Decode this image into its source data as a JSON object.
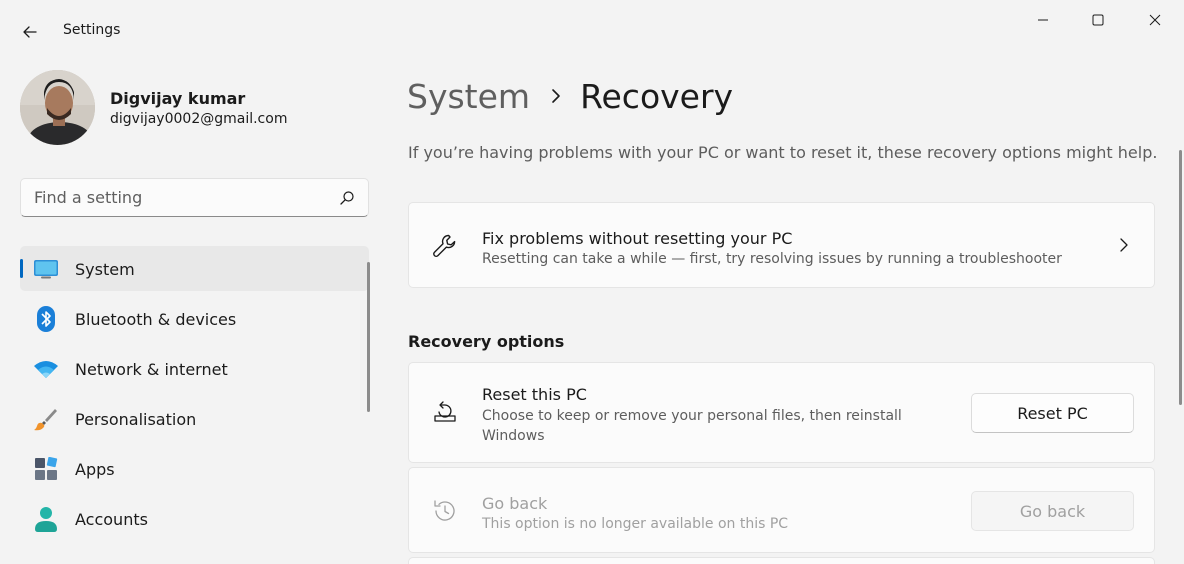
{
  "window": {
    "title": "Settings",
    "controls": {
      "minimize": "minimize-icon",
      "maximize": "maximize-icon",
      "close": "close-icon"
    }
  },
  "profile": {
    "name": "Digvijay kumar",
    "email": "digvijay0002@gmail.com"
  },
  "search": {
    "placeholder": "Find a setting",
    "value": ""
  },
  "sidebar": {
    "accent": "#0067c0",
    "items": [
      {
        "label": "System",
        "icon": "monitor-icon",
        "active": true
      },
      {
        "label": "Bluetooth & devices",
        "icon": "bluetooth-icon"
      },
      {
        "label": "Network & internet",
        "icon": "wifi-icon"
      },
      {
        "label": "Personalisation",
        "icon": "paintbrush-icon"
      },
      {
        "label": "Apps",
        "icon": "apps-icon"
      },
      {
        "label": "Accounts",
        "icon": "account-icon"
      }
    ]
  },
  "main": {
    "breadcrumb": {
      "parent": "System",
      "current": "Recovery"
    },
    "intro": "If you’re having problems with your PC or want to reset it, these recovery options might help.",
    "fix_card": {
      "title": "Fix problems without resetting your PC",
      "description": "Resetting can take a while — first, try resolving issues by running a troubleshooter",
      "icon": "wrench-icon"
    },
    "section_heading": "Recovery options",
    "reset_card": {
      "title": "Reset this PC",
      "description": "Choose to keep or remove your personal files, then reinstall Windows",
      "button": "Reset PC",
      "icon": "reset-pc-icon"
    },
    "goback_card": {
      "title": "Go back",
      "description": "This option is no longer available on this PC",
      "button": "Go back",
      "icon": "history-icon",
      "enabled": false
    }
  }
}
